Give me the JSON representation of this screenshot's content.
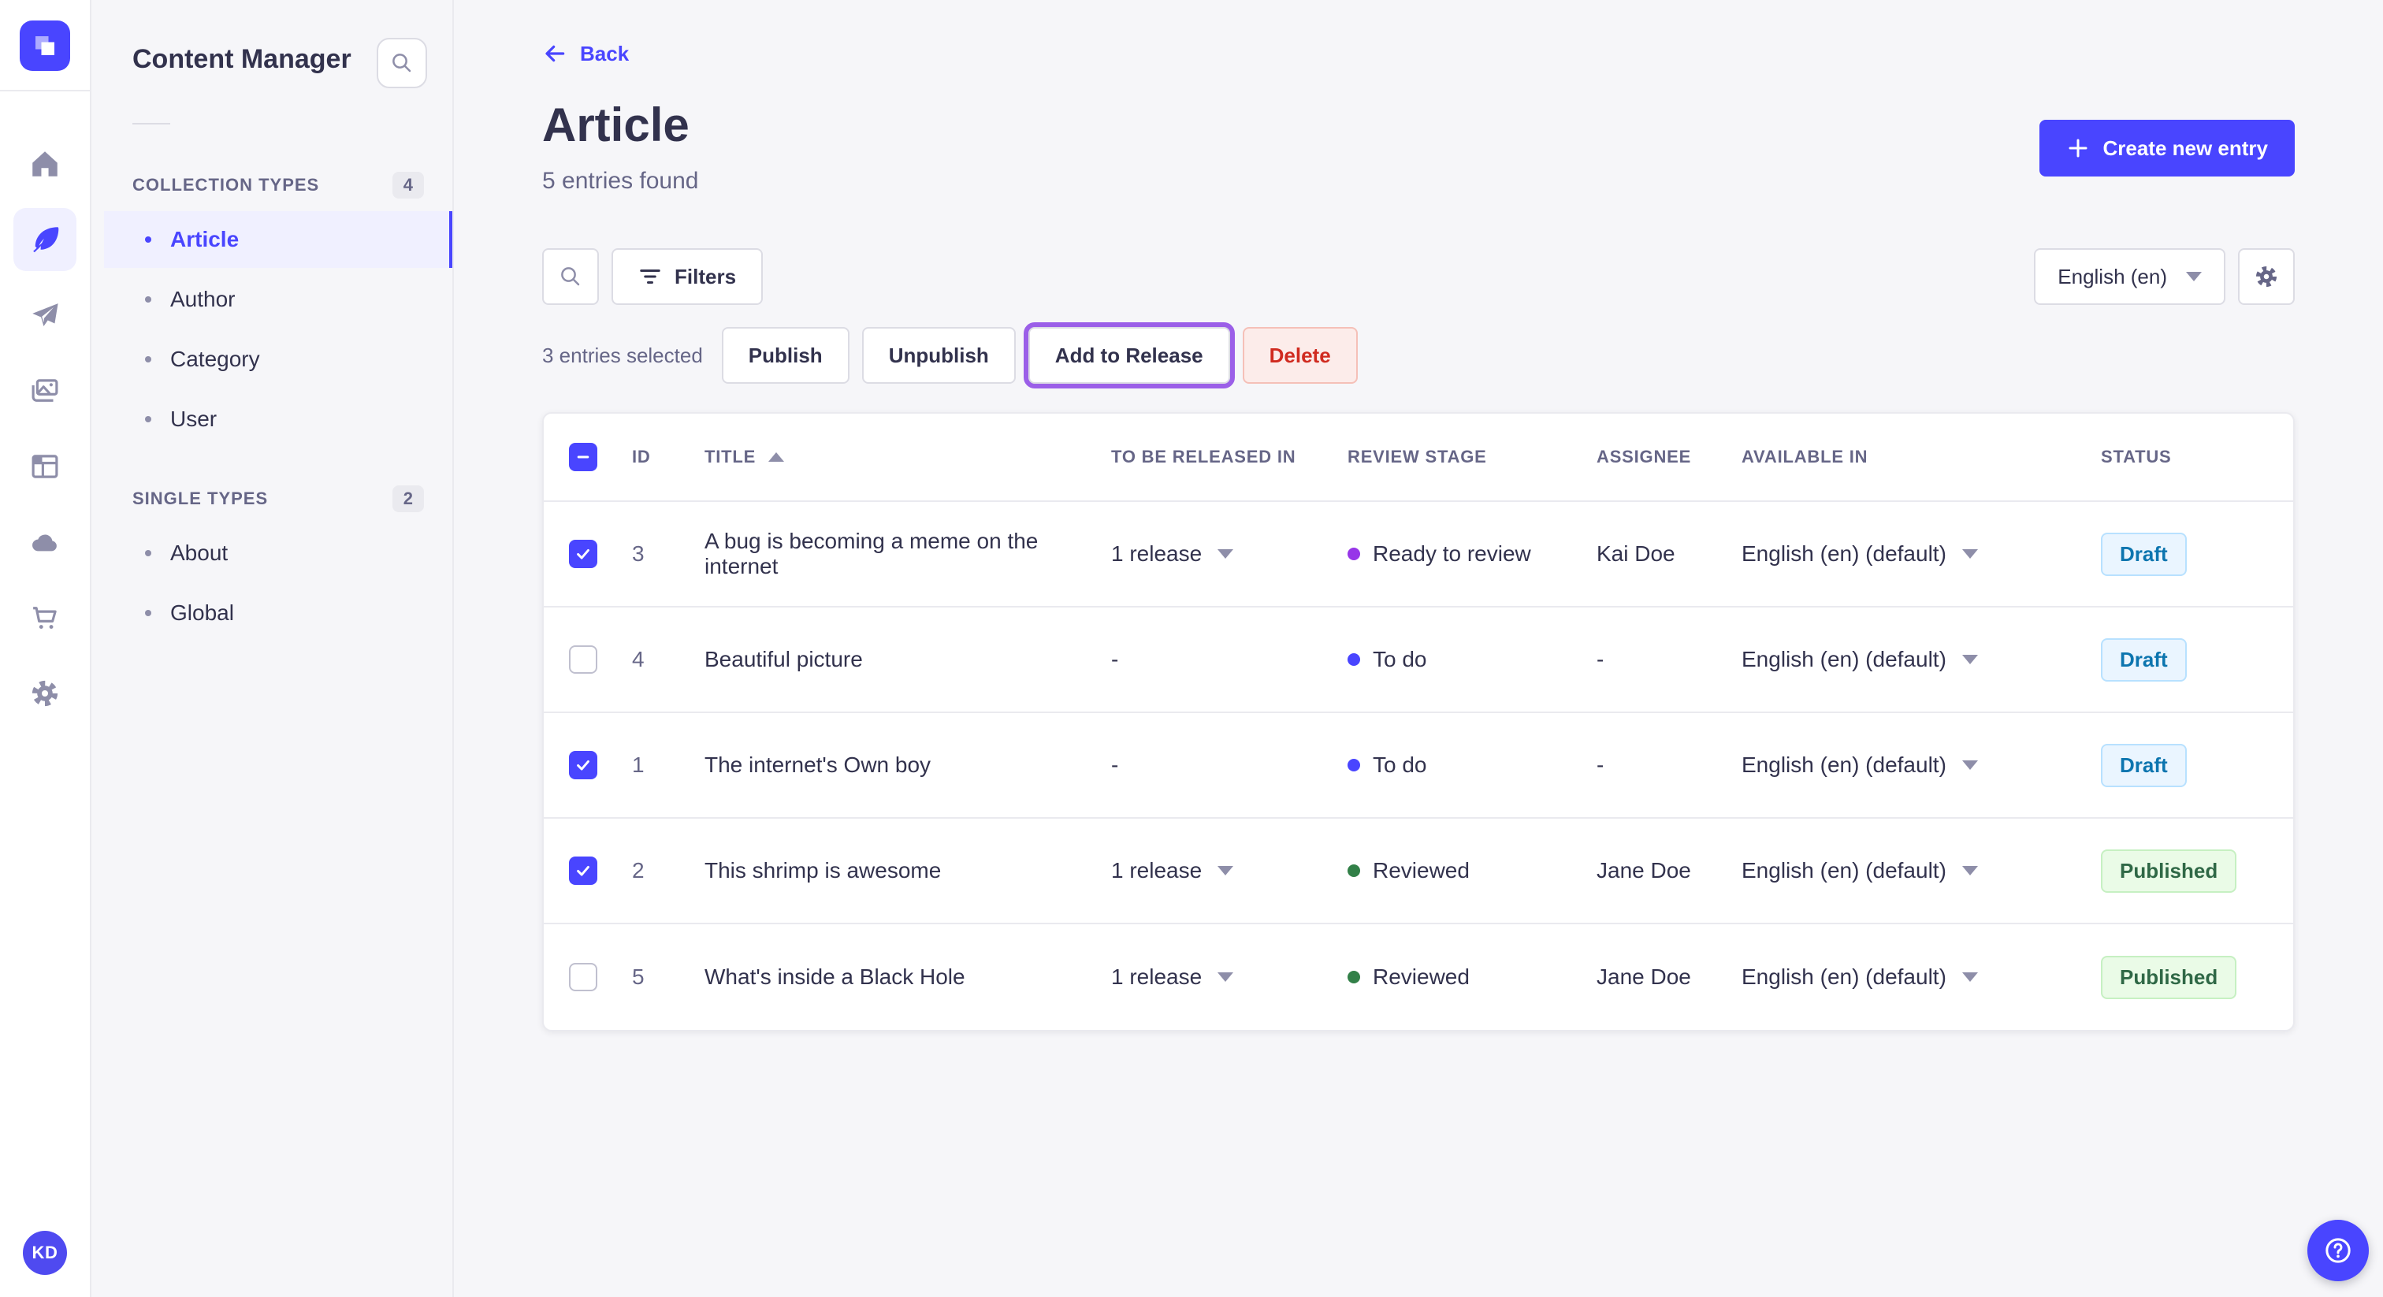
{
  "brand": {
    "logo_icon": "strapi-logo",
    "avatar_initials": "KD"
  },
  "rail_icons": [
    "home-icon",
    "content-feather-icon",
    "send-icon",
    "media-icon",
    "layout-icon",
    "cloud-icon",
    "cart-icon",
    "settings-icon"
  ],
  "subnav": {
    "title": "Content Manager",
    "search_icon": "search-icon",
    "sections": [
      {
        "label": "COLLECTION TYPES",
        "count": "4",
        "items": [
          {
            "label": "Article",
            "active": true
          },
          {
            "label": "Author",
            "active": false
          },
          {
            "label": "Category",
            "active": false
          },
          {
            "label": "User",
            "active": false
          }
        ]
      },
      {
        "label": "SINGLE TYPES",
        "count": "2",
        "items": [
          {
            "label": "About",
            "active": false
          },
          {
            "label": "Global",
            "active": false
          }
        ]
      }
    ]
  },
  "header": {
    "back_label": "Back",
    "title": "Article",
    "subtitle": "5 entries found",
    "create_button_label": "Create new entry"
  },
  "toolbar": {
    "filters_label": "Filters",
    "locale_value": "English (en)",
    "settings_icon": "gear-icon"
  },
  "selection_bar": {
    "selected_text": "3 entries selected",
    "publish_label": "Publish",
    "unpublish_label": "Unpublish",
    "add_to_release_label": "Add to Release",
    "delete_label": "Delete"
  },
  "table": {
    "columns": {
      "id": "ID",
      "title": "TITLE",
      "release": "TO BE RELEASED IN",
      "stage": "REVIEW STAGE",
      "assignee": "ASSIGNEE",
      "available": "AVAILABLE IN",
      "status": "STATUS"
    },
    "sort": {
      "column": "TITLE",
      "direction": "asc"
    },
    "rows": [
      {
        "checked": true,
        "id": "3",
        "title": "A bug is becoming a meme on the internet",
        "release": "1 release",
        "stage": "Ready to review",
        "stage_color": "#9736E8",
        "assignee": "Kai Doe",
        "available": "English (en) (default)",
        "status": "Draft"
      },
      {
        "checked": false,
        "id": "4",
        "title": "Beautiful picture",
        "release": "-",
        "stage": "To do",
        "stage_color": "#4945FF",
        "assignee": "-",
        "available": "English (en) (default)",
        "status": "Draft"
      },
      {
        "checked": true,
        "id": "1",
        "title": "The internet's Own boy",
        "release": "-",
        "stage": "To do",
        "stage_color": "#4945FF",
        "assignee": "-",
        "available": "English (en) (default)",
        "status": "Draft"
      },
      {
        "checked": true,
        "id": "2",
        "title": "This shrimp is awesome",
        "release": "1 release",
        "stage": "Reviewed",
        "stage_color": "#328048",
        "assignee": "Jane Doe",
        "available": "English (en) (default)",
        "status": "Published"
      },
      {
        "checked": false,
        "id": "5",
        "title": "What's inside a Black Hole",
        "release": "1 release",
        "stage": "Reviewed",
        "stage_color": "#328048",
        "assignee": "Jane Doe",
        "available": "English (en) (default)",
        "status": "Published"
      }
    ]
  },
  "colors": {
    "primary": "#4945FF",
    "active_item_bg": "#F0F0FF",
    "draft_text": "#0C75AF",
    "draft_bg": "#EAF5FF",
    "published_text": "#2F6846",
    "published_bg": "#EAFBE7",
    "delete_text": "#D02B20",
    "delete_bg": "#FCECEA",
    "release_outline": "#9B5FE8",
    "stage_todo": "#4945FF",
    "stage_ready_to_review": "#9736E8",
    "stage_reviewed": "#328048"
  },
  "help_fab_icon": "help-question-icon"
}
